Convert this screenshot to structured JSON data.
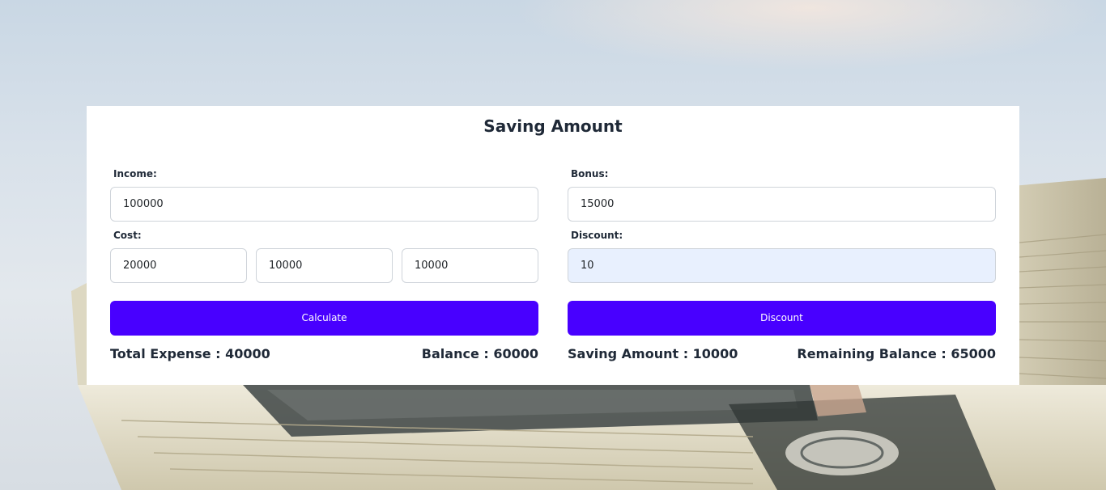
{
  "page": {
    "title": "Saving Amount"
  },
  "income": {
    "label": "Income:",
    "value": "100000"
  },
  "cost": {
    "label": "Cost:",
    "values": [
      "20000",
      "10000",
      "10000"
    ]
  },
  "bonus": {
    "label": "Bonus:",
    "value": "15000"
  },
  "discount": {
    "label": "Discount:",
    "value": "10"
  },
  "buttons": {
    "calculate": "Calculate",
    "discount": "Discount"
  },
  "results": {
    "total_expense": "Total Expense : 40000",
    "balance": "Balance : 60000",
    "saving_amount": "Saving Amount : 10000",
    "remaining_balance": "Remaining Balance : 65000"
  },
  "colors": {
    "button": "#4800ff",
    "active_input": "#e8f0fe"
  },
  "icons": {
    "background": "money-stack-photo"
  }
}
